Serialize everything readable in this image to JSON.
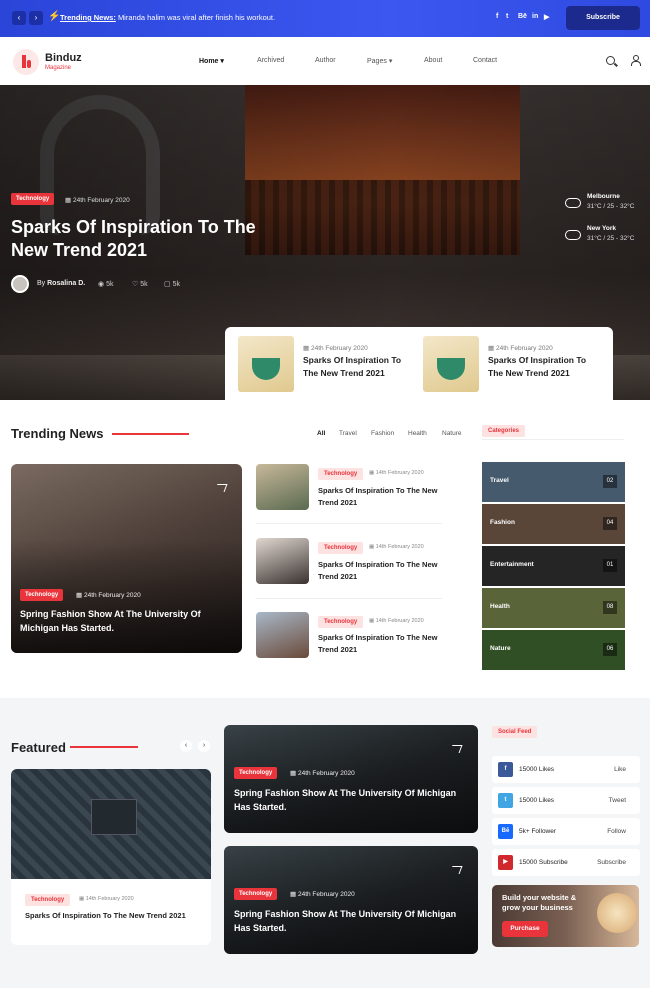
{
  "topbar": {
    "prev_icon": "‹",
    "next_icon": "›",
    "ticker_label": "Trending News:",
    "ticker_text": "Miranda halim was viral after finish his workout.",
    "social": [
      "f",
      "t",
      "Bē",
      "in",
      "▶"
    ],
    "subscribe_label": "Subscribe"
  },
  "nav": {
    "brand": "Binduz",
    "brand_sub": "Magazine",
    "items": [
      "Home",
      "Archived",
      "Author",
      "Pages",
      "About",
      "Contact"
    ]
  },
  "hero": {
    "tag": "Technology",
    "date": "24th February 2020",
    "title": "Sparks Of Inspiration To The New Trend 2021",
    "author_prefix": "By",
    "author": "Rosalina D.",
    "views": "5k",
    "likes": "5k",
    "comments": "5k",
    "weather": [
      {
        "city": "Melbourne",
        "temp": "31°C / 25 - 32°C"
      },
      {
        "city": "New York",
        "temp": "31°C / 25 - 32°C"
      }
    ],
    "cards": [
      {
        "date": "24th February 2020",
        "title": "Sparks Of Inspiration To The New Trend 2021"
      },
      {
        "date": "24th February 2020",
        "title": "Sparks Of Inspiration To The New Trend 2021"
      }
    ]
  },
  "trending": {
    "title": "Trending News",
    "filters": [
      "All",
      "Travel",
      "Fashion",
      "Health",
      "Nature"
    ],
    "big": {
      "tag": "Technology",
      "date": "24th February 2020",
      "title": "Spring Fashion Show At The University Of Michigan Has Started."
    },
    "items": [
      {
        "tag": "Technology",
        "date": "14th February 2020",
        "title": "Sparks Of Inspiration To The New Trend 2021"
      },
      {
        "tag": "Technology",
        "date": "14th February 2020",
        "title": "Sparks Of Inspiration To The New Trend 2021"
      },
      {
        "tag": "Technology",
        "date": "14th February 2020",
        "title": "Sparks Of Inspiration To The New Trend 2021"
      }
    ]
  },
  "categories": {
    "title": "Categories",
    "items": [
      {
        "name": "Travel",
        "count": "02",
        "color": "#6a8aa8"
      },
      {
        "name": "Fashion",
        "count": "04",
        "color": "#8a6a58"
      },
      {
        "name": "Entertainment",
        "count": "01",
        "color": "#3a3a3a"
      },
      {
        "name": "Health",
        "count": "08",
        "color": "#8a9a58"
      },
      {
        "name": "Nature",
        "count": "06",
        "color": "#4a7a3a"
      }
    ]
  },
  "featured": {
    "title": "Featured",
    "prev_icon": "‹",
    "next_icon": "›",
    "card": {
      "tag": "Technology",
      "date": "14th February 2020",
      "title": "Sparks Of Inspiration To The New Trend 2021"
    },
    "mid": [
      {
        "tag": "Technology",
        "date": "24th February 2020",
        "title": "Spring Fashion Show At The University Of Michigan Has Started."
      },
      {
        "tag": "Technology",
        "date": "24th February 2020",
        "title": "Spring Fashion Show At The University Of Michigan Has Started."
      }
    ]
  },
  "social_feed": {
    "title": "Social Feed",
    "items": [
      {
        "icon": "f",
        "count": "15000 Likes",
        "action": "Like",
        "color": "#3b5998"
      },
      {
        "icon": "t",
        "count": "15000 Likes",
        "action": "Tweet",
        "color": "#41a5e3"
      },
      {
        "icon": "Bē",
        "count": "5k+ Follower",
        "action": "Follow",
        "color": "#1769ff"
      },
      {
        "icon": "▶",
        "count": "15000 Subscribe",
        "action": "Subscribe",
        "color": "#d0282c"
      }
    ],
    "promo_text": "Build your website & grow your business",
    "promo_button": "Purchase"
  },
  "colors": {
    "accent": "#e8343a",
    "topbar": "#3b57f0"
  }
}
